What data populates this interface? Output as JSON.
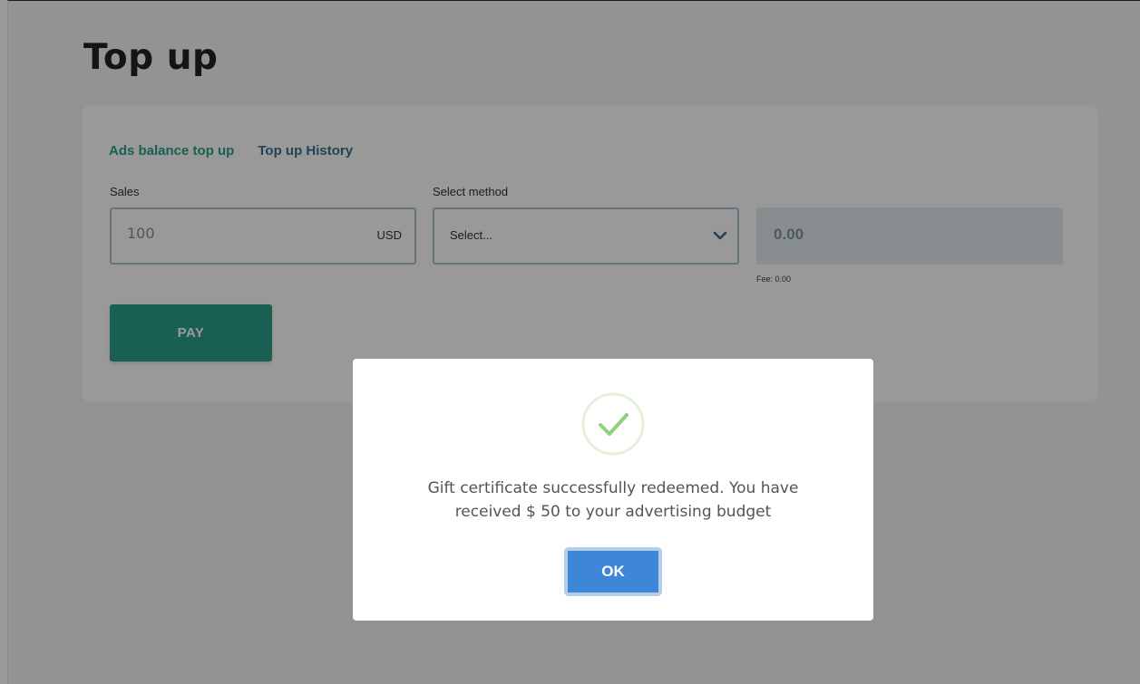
{
  "page": {
    "title": "Top up"
  },
  "tabs": [
    {
      "label": "Ads balance top up",
      "active": true
    },
    {
      "label": "Top up History",
      "active": false
    }
  ],
  "form": {
    "sales_label": "Sales",
    "sales_value": "100",
    "currency": "USD",
    "method_label": "Select method",
    "method_selected": "Select...",
    "total": "0.00",
    "fee": "Fee: 0.00",
    "pay_label": "PAY"
  },
  "modal": {
    "icon": "checkmark-icon",
    "message_line1": "Gift certificate successfully redeemed. You have",
    "message_line2": "received $ 50 to your advertising budget",
    "ok_label": "OK"
  },
  "colors": {
    "accent": "#2ba189",
    "link": "#3b6e8b",
    "primary_button": "#3d86d8",
    "success": "#8fd17f"
  }
}
